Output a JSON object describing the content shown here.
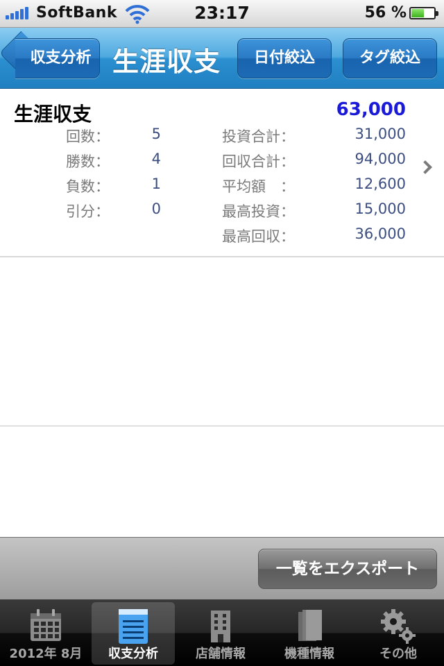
{
  "status_bar": {
    "carrier": "SoftBank",
    "time": "23:17",
    "battery_percent": "56 %",
    "battery_level": 0.56
  },
  "nav": {
    "back_label": "収支分析",
    "title": "生涯収支",
    "date_filter_label": "日付絞込",
    "tag_filter_label": "タグ絞込"
  },
  "summary": {
    "title": "生涯収支",
    "total": "63,000",
    "left_stats": [
      {
        "label": "回数：",
        "value": "5"
      },
      {
        "label": "勝数：",
        "value": "4"
      },
      {
        "label": "負数：",
        "value": "1"
      },
      {
        "label": "引分：",
        "value": "0"
      }
    ],
    "right_stats": [
      {
        "label": "投資合計：",
        "value": "31,000"
      },
      {
        "label": "回収合計：",
        "value": "94,000"
      },
      {
        "label": "平均額　：",
        "value": "12,600"
      },
      {
        "label": "最高投資：",
        "value": "15,000"
      },
      {
        "label": "最高回収：",
        "value": "36,000"
      }
    ]
  },
  "toolbar": {
    "export_label": "一覧をエクスポート"
  },
  "tabs": [
    {
      "label": "2012年 8月",
      "icon": "calendar-icon"
    },
    {
      "label": "収支分析",
      "icon": "notepad-icon",
      "active": true
    },
    {
      "label": "店舗情報",
      "icon": "building-icon"
    },
    {
      "label": "機種情報",
      "icon": "books-icon"
    },
    {
      "label": "その他",
      "icon": "gears-icon"
    }
  ],
  "colors": {
    "nav_blue": "#2b8fd0",
    "total_blue": "#1a1ad8",
    "value_blue": "#3b4d80"
  }
}
